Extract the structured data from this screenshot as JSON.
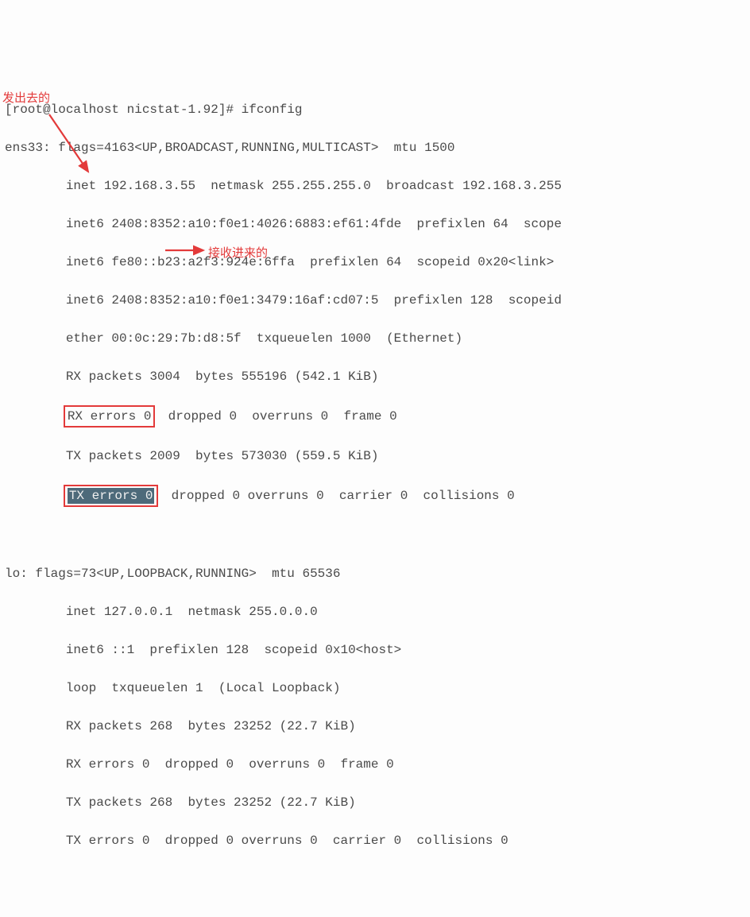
{
  "prompt": "[root@localhost nicstat-1.92]# ",
  "command": "ifconfig",
  "ens33": {
    "name": "ens33:",
    "flags": " flags=4163<UP,BROADCAST,RUNNING,MULTICAST>  mtu 1500",
    "inet": "        inet 192.168.3.55  netmask 255.255.255.0  broadcast 192.168.3.255",
    "inet6a": "        inet6 2408:8352:a10:f0e1:4026:6883:ef61:4fde  prefixlen 64  scope",
    "inet6b": "        inet6 fe80::b23:a2f3:924e:6ffa  prefixlen 64  scopeid 0x20<link>",
    "inet6c": "        inet6 2408:8352:a10:f0e1:3479:16af:cd07:5  prefixlen 128  scopeid",
    "ether": "        ether 00:0c:29:7b:d8:5f  txqueuelen 1000  (Ethernet)",
    "rxp": "        RX packets 3004  bytes 555196 (542.1 KiB)",
    "rxe_pre": "        ",
    "rxe_box": "RX errors 0",
    "rxe_post": "  dropped 0  overruns 0  frame 0",
    "txp": "        TX packets 2009  bytes 573030 (559.5 KiB)",
    "txe_pre": "        ",
    "txe_sel": "TX errors 0",
    "txe_post": "  dropped 0 overruns 0  carrier 0  collisions 0"
  },
  "lo": {
    "name": "lo:",
    "flags": " flags=73<UP,LOOPBACK,RUNNING>  mtu 65536",
    "inet": "        inet 127.0.0.1  netmask 255.0.0.0",
    "inet6": "        inet6 ::1  prefixlen 128  scopeid 0x10<host>",
    "loop": "        loop  txqueuelen 1  (Local Loopback)",
    "rxp": "        RX packets 268  bytes 23252 (22.7 KiB)",
    "rxe": "        RX errors 0  dropped 0  overruns 0  frame 0",
    "txp": "        TX packets 268  bytes 23252 (22.7 KiB)",
    "txe": "        TX errors 0  dropped 0 overruns 0  carrier 0  collisions 0"
  },
  "annotations": {
    "out": "发出去的",
    "in": "接收进来的"
  },
  "colors": {
    "red": "#e33a3a",
    "selbg": "#4d6a7a"
  }
}
